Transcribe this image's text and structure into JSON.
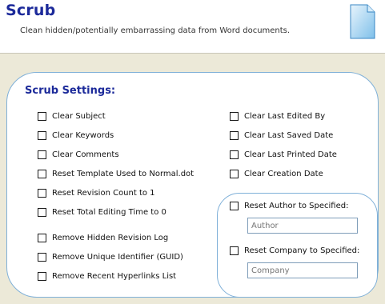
{
  "header": {
    "title": "Scrub",
    "subtitle": "Clean hidden/potentially embarrassing data from Word documents."
  },
  "panel": {
    "title": "Scrub Settings:",
    "left_options": [
      {
        "label": "Clear Subject",
        "checked": false
      },
      {
        "label": "Clear Keywords",
        "checked": false
      },
      {
        "label": "Clear Comments",
        "checked": false
      },
      {
        "label": "Reset Template Used to Normal.dot",
        "checked": false
      },
      {
        "label": "Reset Revision Count to 1",
        "checked": false
      },
      {
        "label": "Reset Total Editing Time to 0",
        "checked": false
      },
      {
        "label": "Remove Hidden Revision Log",
        "checked": false
      },
      {
        "label": "Remove Unique Identifier (GUID)",
        "checked": false
      },
      {
        "label": "Remove Recent Hyperlinks List",
        "checked": false
      }
    ],
    "right_options": [
      {
        "label": "Clear Last Edited By",
        "checked": false
      },
      {
        "label": "Clear Last Saved Date",
        "checked": false
      },
      {
        "label": "Clear Last Printed Date",
        "checked": false
      },
      {
        "label": "Clear Creation Date",
        "checked": false
      }
    ],
    "author": {
      "label": "Reset Author to Specified:",
      "placeholder": "Author",
      "checked": false
    },
    "company": {
      "label": "Reset Company to Specified:",
      "placeholder": "Company",
      "checked": false
    }
  },
  "icons": {
    "header": "document-icon"
  },
  "colors": {
    "title": "#1c2a9a",
    "panel_border": "#7fb0d8",
    "background": "#ece9d8"
  }
}
